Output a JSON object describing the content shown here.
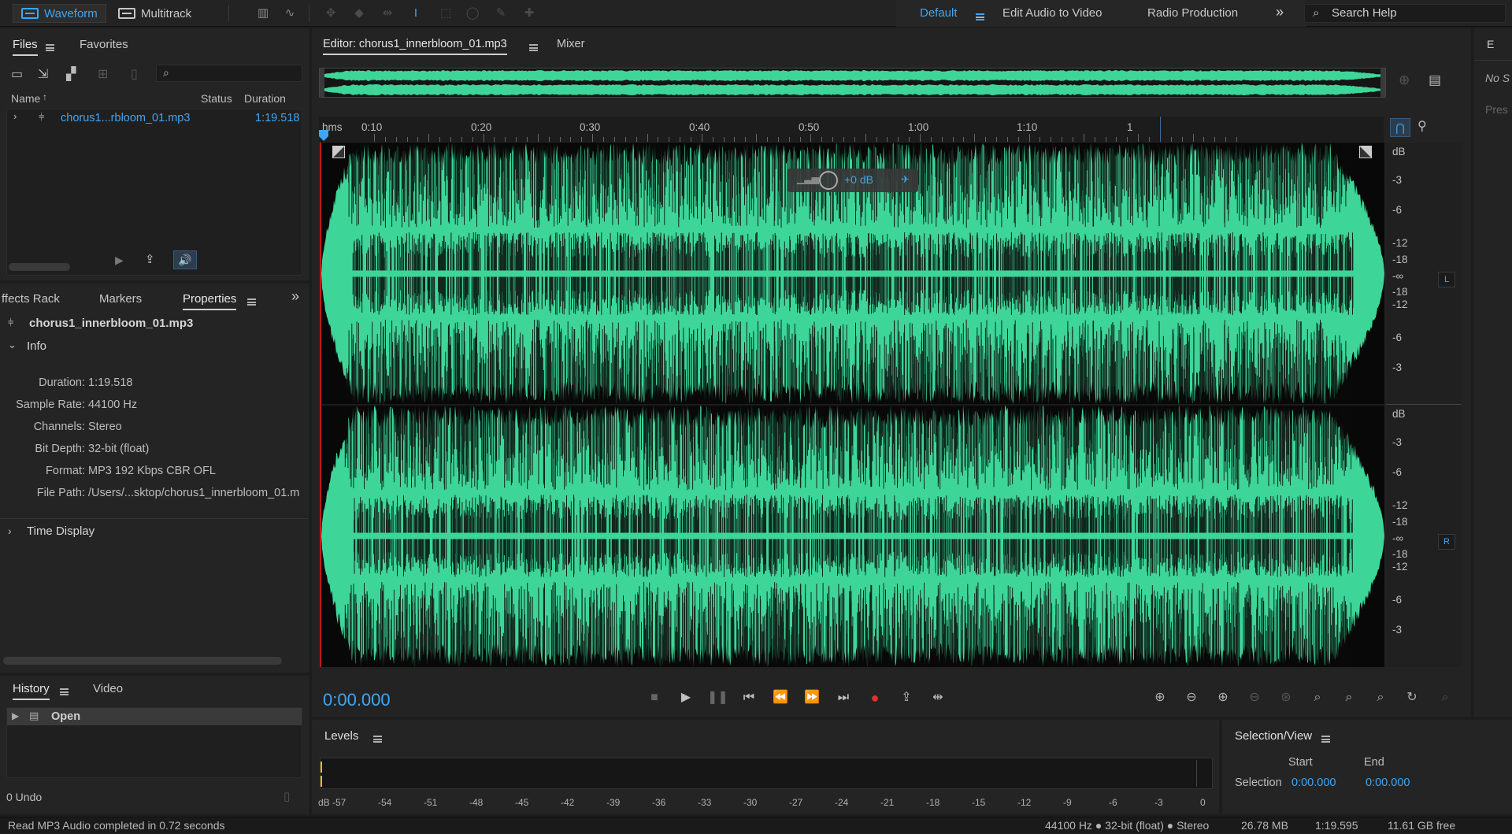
{
  "topbar": {
    "modes": [
      "Waveform",
      "Multitrack"
    ],
    "workspaces": [
      "Default",
      "Edit Audio to Video",
      "Radio Production"
    ],
    "search_placeholder": "Search Help"
  },
  "files_panel": {
    "tabs": [
      "Files",
      "Favorites"
    ],
    "columns": [
      "Name",
      "Status",
      "Duration"
    ],
    "items": [
      {
        "name": "chorus1...rbloom_01.mp3",
        "duration": "1:19.518"
      }
    ]
  },
  "props_panel": {
    "tabs": [
      "ffects Rack",
      "Markers",
      "Properties"
    ],
    "filename": "chorus1_innerbloom_01.mp3",
    "info_title": "Info",
    "rows": [
      {
        "k": "Duration:",
        "v": "1:19.518"
      },
      {
        "k": "Sample Rate:",
        "v": "44100 Hz"
      },
      {
        "k": "Channels:",
        "v": "Stereo"
      },
      {
        "k": "Bit Depth:",
        "v": "32-bit (float)"
      },
      {
        "k": "Format:",
        "v": "MP3 192 Kbps CBR OFL"
      },
      {
        "k": "File Path:",
        "v": "/Users/...sktop/chorus1_innerbloom_01.m"
      }
    ],
    "time_display": "Time Display"
  },
  "history_panel": {
    "tabs": [
      "History",
      "Video"
    ],
    "items": [
      "Open"
    ],
    "undo_count": "0 Undo"
  },
  "editor": {
    "tabs": [
      "Editor: chorus1_innerbloom_01.mp3",
      "Mixer"
    ],
    "ruler_labels": [
      "hms",
      "0:10",
      "0:20",
      "0:30",
      "0:40",
      "0:50",
      "1:00",
      "1:10",
      "1"
    ],
    "db_labels_left": [
      "dB",
      "-3",
      "-6",
      "-12",
      "-18",
      "-∞",
      "-18",
      "-12",
      "-6",
      "-3"
    ],
    "db_labels_right": [
      "dB",
      "-3",
      "-6",
      "-12",
      "-18",
      "-∞",
      "-18",
      "-12",
      "-6",
      "-3"
    ],
    "channel_badges": [
      "L",
      "R"
    ],
    "hud_gain": "+0 dB",
    "current_time": "0:00.000",
    "waveform_color": "#3dd698"
  },
  "levels": {
    "title": "Levels",
    "scale": [
      "dB",
      "-57",
      "-54",
      "-51",
      "-48",
      "-45",
      "-42",
      "-39",
      "-36",
      "-33",
      "-30",
      "-27",
      "-24",
      "-21",
      "-18",
      "-15",
      "-12",
      "-9",
      "-6",
      "-3",
      "0"
    ]
  },
  "selection_view": {
    "title": "Selection/View",
    "col_start": "Start",
    "col_end": "End",
    "row_label": "Selection",
    "start": "0:00.000",
    "end": "0:00.000"
  },
  "right_stub": {
    "letter": "E",
    "line1": "No S",
    "line2": "Pres"
  },
  "status": {
    "message": "Read MP3 Audio completed in 0.72 seconds",
    "format": "44100 Hz ● 32-bit (float) ● Stereo",
    "size": "26.78 MB",
    "duration": "1:19.595",
    "free": "11.61 GB free"
  }
}
